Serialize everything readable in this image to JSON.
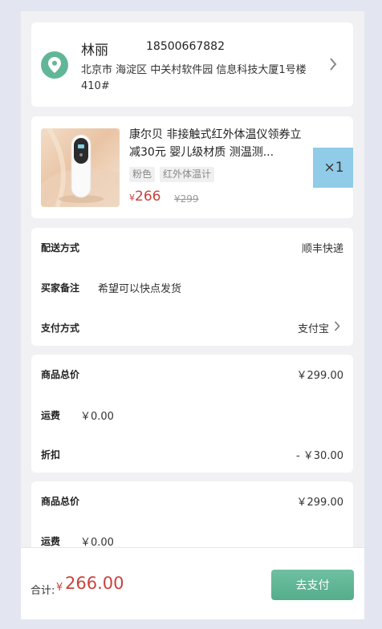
{
  "address": {
    "name": "林丽",
    "phone": "18500667882",
    "detail": "北京市 海淀区 中关村软件园 信息科技大厦1号楼410#"
  },
  "product": {
    "title": "康尔贝 非接触式红外体温仪领券立减30元 婴儿级材质 测温测...",
    "specs": [
      "粉色",
      "红外体温计"
    ],
    "currency": "¥",
    "price": "266",
    "original_price": "¥299",
    "quantity": "×1"
  },
  "order": {
    "delivery_label": "配送方式",
    "delivery_value": "顺丰快递",
    "note_label": "买家备注",
    "note_value": "希望可以快点发货",
    "payment_label": "支付方式",
    "payment_value": "支付宝"
  },
  "summary": {
    "goods_total_label": "商品总价",
    "goods_total_value": "￥299.00",
    "shipping_label": "运费",
    "shipping_value": "￥0.00",
    "discount_label": "折扣",
    "discount_value": "- ￥30.00"
  },
  "summary_repeat": {
    "goods_total_label": "商品总价",
    "goods_total_value": "￥299.00",
    "shipping_label": "运费",
    "shipping_value": "￥0.00"
  },
  "footer": {
    "total_label": "合计:",
    "currency": "¥",
    "total_value": "266.00",
    "pay_label": "去支付"
  },
  "colors": {
    "accent": "#5fb595",
    "price": "#c9433d",
    "quantity_bg": "#90cbe7"
  }
}
